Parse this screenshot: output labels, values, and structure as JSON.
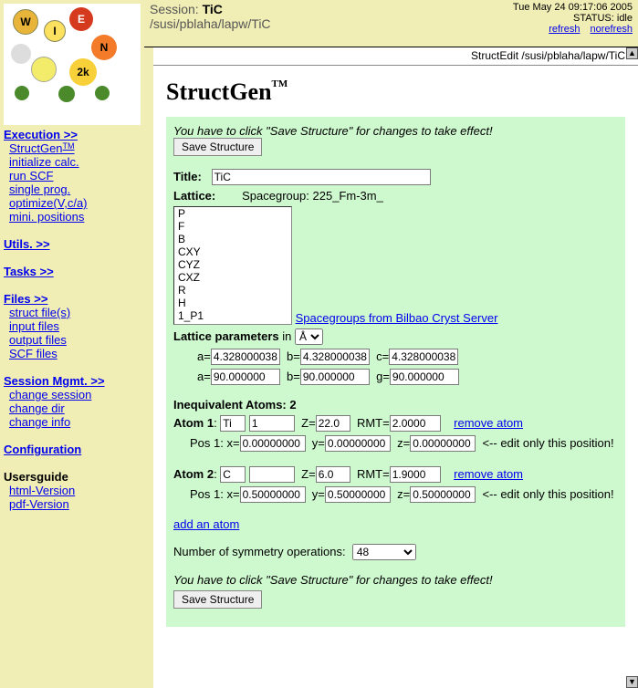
{
  "header": {
    "session_label": "Session:",
    "session_name": "TiC",
    "path": "/susi/pblaha/lapw/TiC",
    "datetime": "Tue May 24 09:17:06 2005",
    "status_label": "STATUS:",
    "status_value": "idle",
    "refresh": "refresh",
    "norefresh": "norefresh",
    "crumb": "StructEdit /susi/pblaha/lapw/TiC"
  },
  "nav": {
    "execution": "Execution >>",
    "structgen": "StructGen",
    "init": "initialize calc.",
    "runscf": "run SCF",
    "single": "single prog.",
    "optimize": "optimize(V,c/a)",
    "mini": "mini. positions",
    "utils": "Utils. >>",
    "tasks": "Tasks >>",
    "files": "Files >>",
    "struct_files": "struct file(s)",
    "input_files": "input files",
    "output_files": "output files",
    "scf_files": "SCF files",
    "sessmgmt": "Session Mgmt. >>",
    "change_session": "change session",
    "change_dir": "change dir",
    "change_info": "change info",
    "config": "Configuration",
    "usersguide": "Usersguide",
    "html_v": "html-Version",
    "pdf_v": "pdf-Version"
  },
  "main": {
    "title": "StructGen",
    "tm": "TM",
    "notice": "You have to click \"Save Structure\" for changes to take effect!",
    "save": "Save Structure",
    "title_label": "Title:",
    "title_value": "TiC",
    "lattice_label": "Lattice:",
    "sg_label": "Spacegroup:",
    "sg_value": "225_Fm-3m_",
    "options": [
      "P",
      "F",
      "B",
      "CXY",
      "CYZ",
      "CXZ",
      "R",
      "H",
      "1_P1"
    ],
    "bilbao": "Spacegroups from Bilbao Cryst Server",
    "latparam_label": "Lattice parameters",
    "in_label": "in",
    "unit": "Å",
    "a": "4.328000038",
    "b": "4.328000038",
    "c": "4.328000038",
    "alpha": "90.000000",
    "beta": "90.000000",
    "gamma": "90.000000",
    "ineq_label": "Inequivalent Atoms:",
    "ineq_count": "2",
    "atom1_label": "Atom 1",
    "atom1_sym": "Ti",
    "atom1_num": "1",
    "atom1_z": "22.0",
    "atom1_rmt": "2.0000",
    "atom2_label": "Atom 2",
    "atom2_sym": "C",
    "atom2_num": "",
    "atom2_z": "6.0",
    "atom2_rmt": "1.9000",
    "z_label": "Z=",
    "rmt_label": "RMT=",
    "remove": "remove atom",
    "pos1_label": "Pos 1: x=",
    "y_label": "y=",
    "z2_label": "z=",
    "a1x": "0.00000000",
    "a1y": "0.00000000",
    "a1z": "0.00000000",
    "a2x": "0.50000000",
    "a2y": "0.50000000",
    "a2z": "0.50000000",
    "edit_note": "<-- edit only this position!",
    "add_atom": "add an atom",
    "symop_label": "Number of symmetry operations:",
    "symop_value": "48"
  }
}
